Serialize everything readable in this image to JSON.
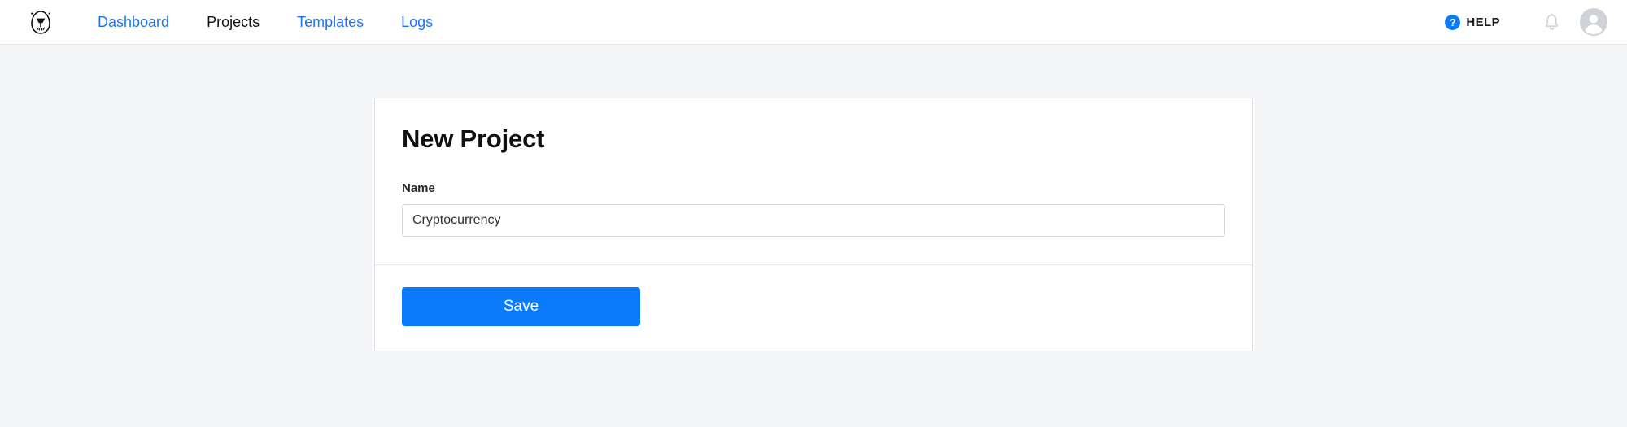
{
  "theme": {
    "accent_blue": "#0b7bfb",
    "link_blue": "#1a73fb",
    "page_background": "#f4f5f7",
    "card_background": "#ffffff",
    "border_gray": "#e1e3e6"
  },
  "navbar": {
    "logo_name": "egg-logo",
    "links": [
      {
        "label": "Dashboard",
        "active": false
      },
      {
        "label": "Projects",
        "active": true
      },
      {
        "label": "Templates",
        "active": false
      },
      {
        "label": "Logs",
        "active": false
      }
    ],
    "help": {
      "icon": "question-mark-circle-icon",
      "label": "HELP"
    },
    "notifications_icon": "bell-icon",
    "avatar_icon": "user-avatar-icon"
  },
  "card": {
    "title": "New Project",
    "form": {
      "name_field": {
        "label": "Name",
        "value": "Cryptocurrency",
        "placeholder": "Name"
      }
    },
    "footer": {
      "save_label": "Save"
    }
  }
}
